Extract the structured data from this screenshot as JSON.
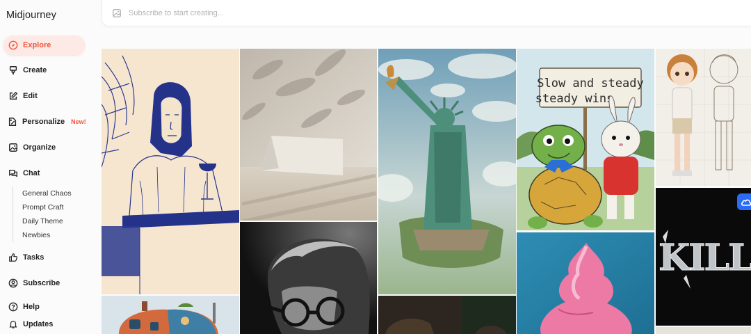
{
  "app": {
    "title": "Midjourney"
  },
  "nav": {
    "explore": "Explore",
    "create": "Create",
    "edit": "Edit",
    "personalize": "Personalize",
    "personalize_badge": "New!",
    "organize": "Organize",
    "chat": "Chat",
    "chat_channels": [
      "General Chaos",
      "Prompt Craft",
      "Daily Theme",
      "Newbies"
    ],
    "tasks": "Tasks",
    "subscribe": "Subscribe",
    "help": "Help",
    "updates": "Updates"
  },
  "search": {
    "placeholder": "Subscribe to start creating..."
  },
  "gallery": {
    "sign_text_line1": "Slow and steady",
    "sign_text_line2": "steady wins",
    "logo_text": "KILLE"
  },
  "colors": {
    "accent": "#f2553a",
    "accent_bg": "#fde9e5",
    "cloud_button": "#2a6cf5"
  }
}
